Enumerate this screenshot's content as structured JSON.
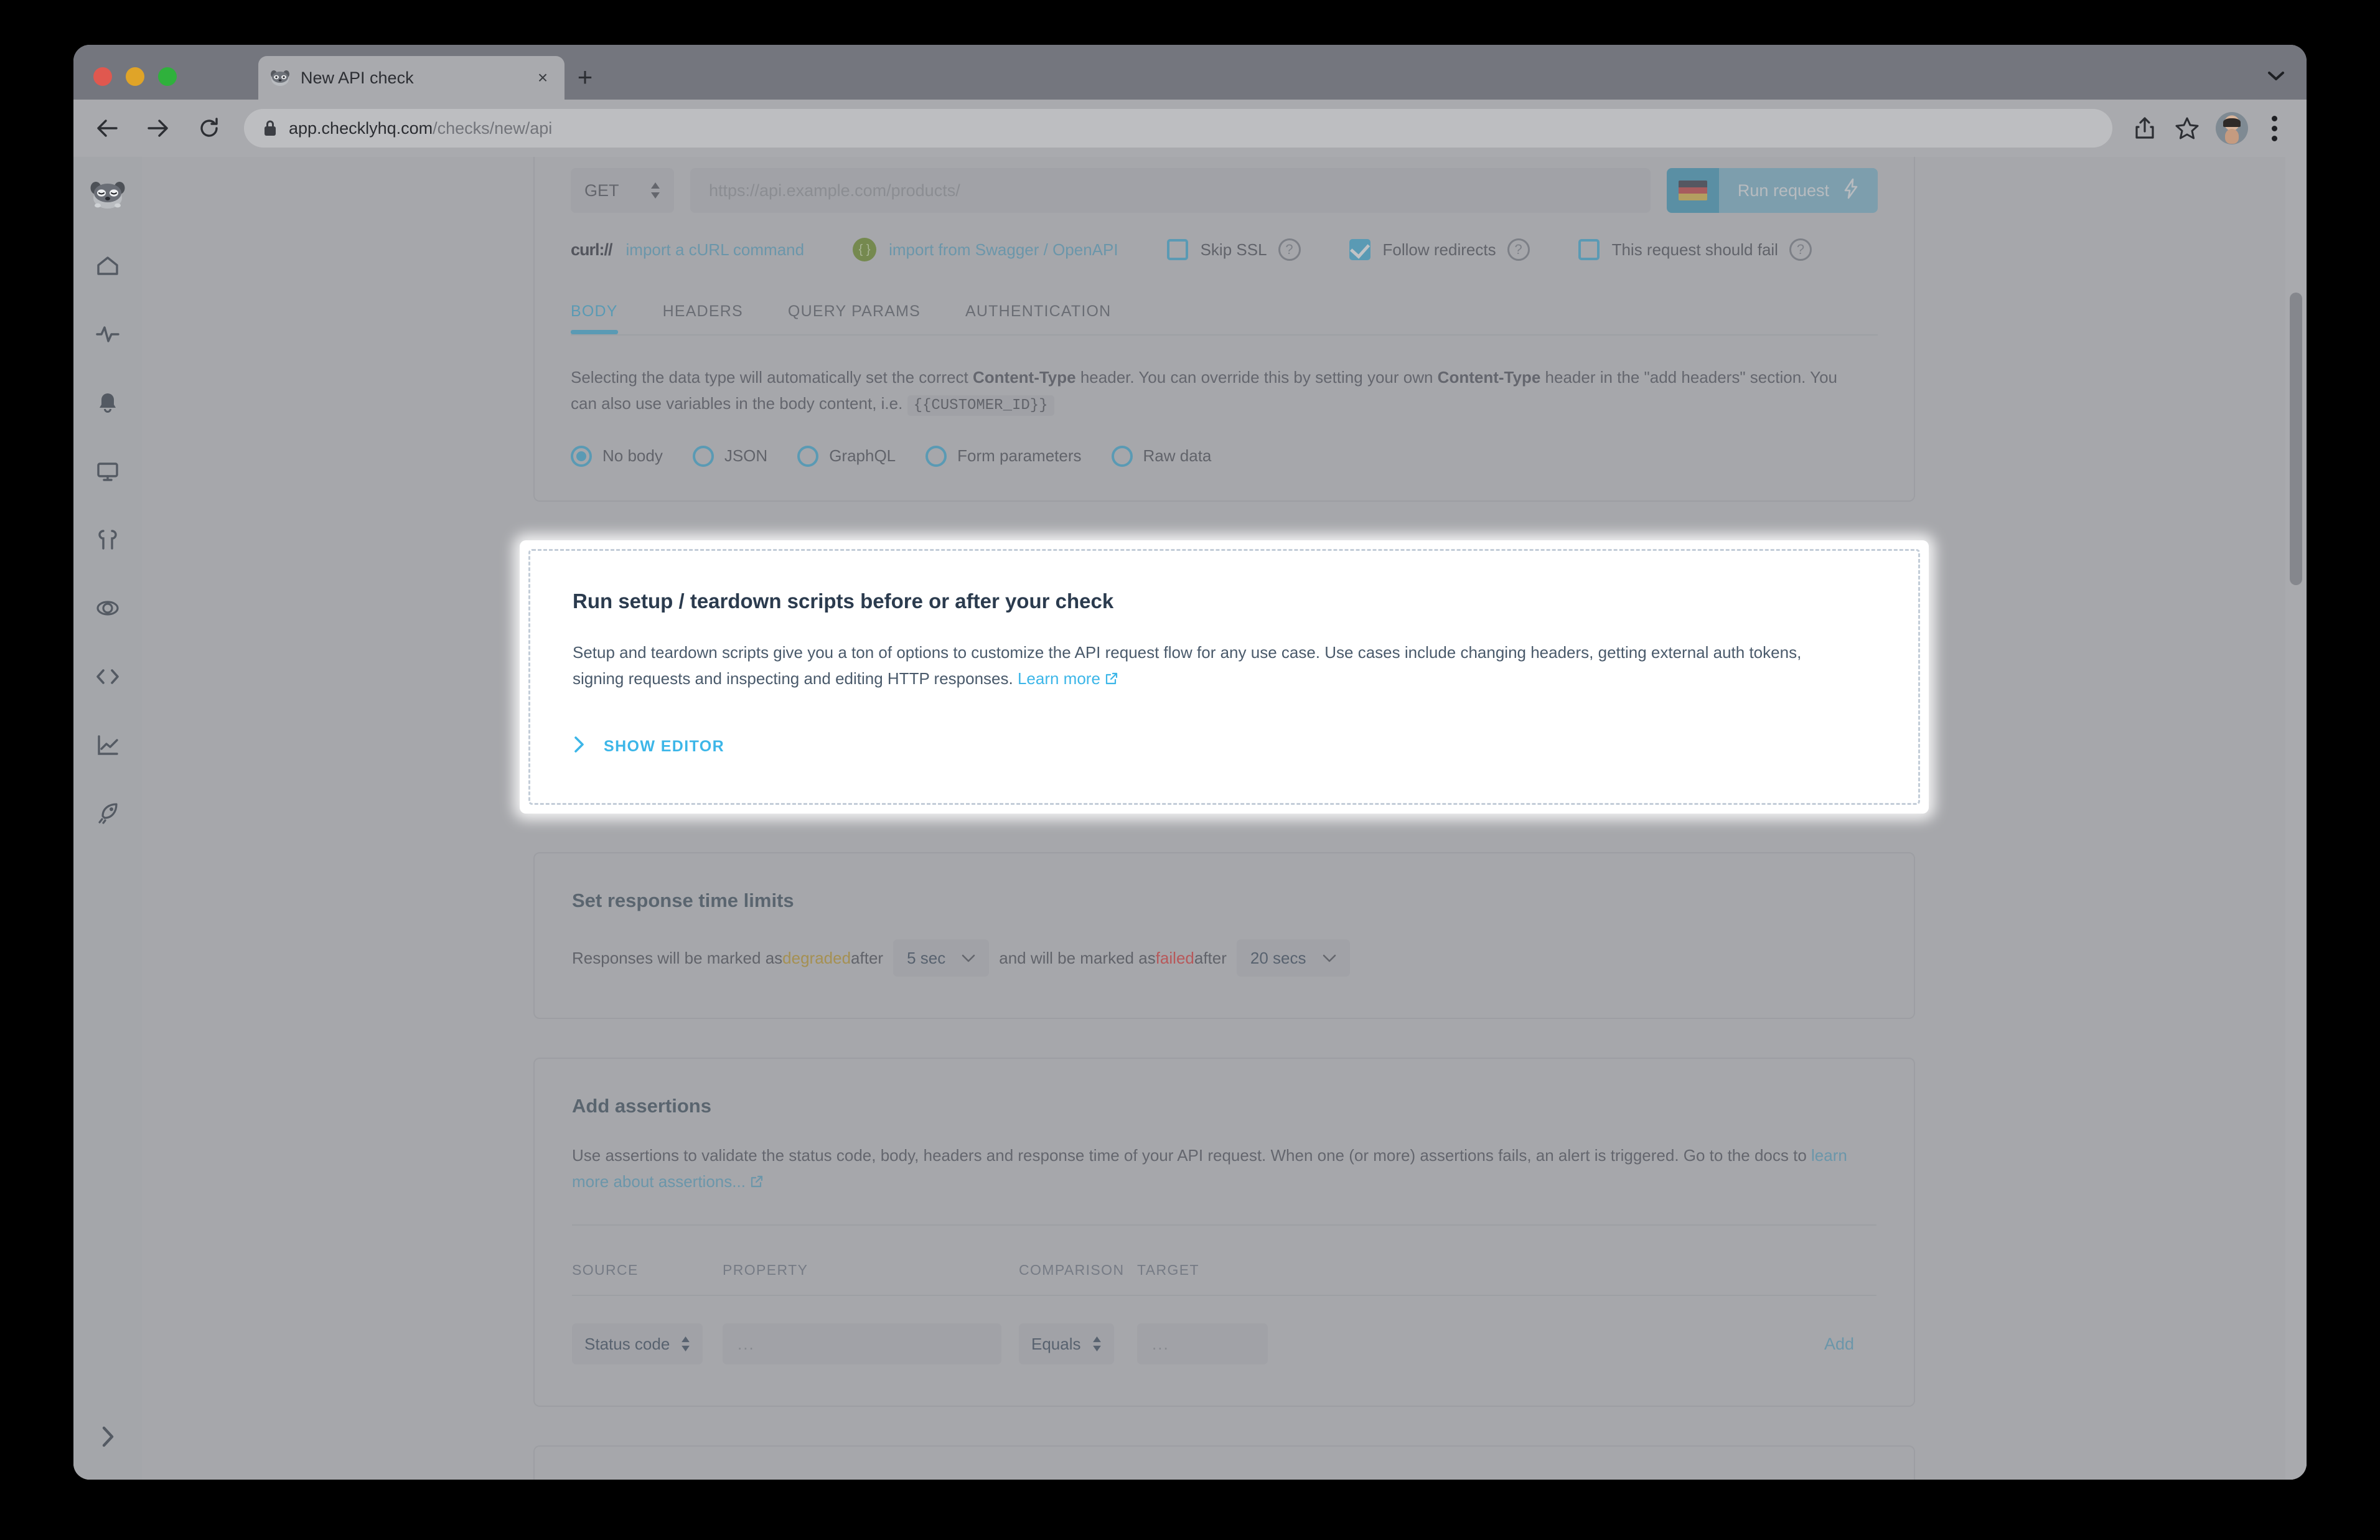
{
  "browser": {
    "tab": {
      "title": "New API check",
      "favicon": "raccoon-icon",
      "close": "×"
    },
    "new_tab": "+",
    "tab_search_icon": "chevron-down-icon",
    "nav": {
      "back": "back-icon",
      "forward": "forward-icon",
      "reload": "reload-icon"
    },
    "omnibox": {
      "lock": "lock-icon",
      "domain": "app.checklyhq.com",
      "path": "/checks/new/api"
    },
    "actions": {
      "share": "share-icon",
      "bookmark": "star-icon",
      "profile": "avatar",
      "menu": "kebab-menu-icon"
    }
  },
  "sidebar": {
    "logo": "checkly-raccoon-logo",
    "items": [
      {
        "name": "home",
        "icon": "home-icon"
      },
      {
        "name": "activity",
        "icon": "pulse-icon"
      },
      {
        "name": "alerts",
        "icon": "bell-icon"
      },
      {
        "name": "dashboards",
        "icon": "monitor-icon"
      },
      {
        "name": "maintenance",
        "icon": "wrench-icon"
      },
      {
        "name": "locations",
        "icon": "globe-icon"
      },
      {
        "name": "code",
        "icon": "code-brackets-icon"
      },
      {
        "name": "analytics",
        "icon": "line-chart-icon"
      },
      {
        "name": "deploy",
        "icon": "rocket-icon"
      }
    ],
    "expand_icon": "chevron-right-icon"
  },
  "request": {
    "method": "GET",
    "method_caret": "updown-caret-icon",
    "url_placeholder": "https://api.example.com/products/",
    "flag": "de-flag-icon",
    "run_label": "Run request",
    "run_icon": "lightning-icon",
    "curl_logo": "curl://",
    "import_curl": "import a cURL command",
    "swagger_icon": "swagger-icon",
    "import_swagger": "import from Swagger / OpenAPI",
    "checkboxes": [
      {
        "label": "Skip SSL",
        "checked": false,
        "help": "?"
      },
      {
        "label": "Follow redirects",
        "checked": true,
        "help": "?"
      },
      {
        "label": "This request should fail",
        "checked": false,
        "help": "?"
      }
    ],
    "tabs": [
      {
        "label": "BODY",
        "active": true
      },
      {
        "label": "HEADERS",
        "active": false
      },
      {
        "label": "QUERY PARAMS",
        "active": false
      },
      {
        "label": "AUTHENTICATION",
        "active": false
      }
    ],
    "body_desc_1": "Selecting the data type will automatically set the correct ",
    "body_desc_ct1": "Content-Type",
    "body_desc_2": " header. You can override this by setting your own ",
    "body_desc_ct2": "Content-Type",
    "body_desc_3": " header in the \"add headers\" section. You can also use variables in the body content, i.e. ",
    "body_variable": "{{CUSTOMER_ID}}",
    "body_options": [
      {
        "label": "No body",
        "selected": true
      },
      {
        "label": "JSON",
        "selected": false
      },
      {
        "label": "GraphQL",
        "selected": false
      },
      {
        "label": "Form parameters",
        "selected": false
      },
      {
        "label": "Raw data",
        "selected": false
      }
    ]
  },
  "scripts_card": {
    "title": "Run setup / teardown scripts before or after your check",
    "description": "Setup and teardown scripts give you a ton of options to customize the API request flow for any use case. Use cases include changing headers, getting external auth tokens, signing requests and inspecting and editing HTTP responses. ",
    "learn_more": "Learn more",
    "external_icon": "external-link-icon",
    "show_editor": "SHOW EDITOR",
    "chevron": "chevron-right-icon",
    "highlight_color": "#ffffff",
    "dashed_border_color": "#c3cdd8"
  },
  "response_limits": {
    "title": "Set response time limits",
    "text_1": "Responses will be marked as ",
    "degraded": "degraded",
    "text_2": " after ",
    "degraded_value": "5 sec",
    "text_3": " and will be marked as ",
    "failed": "failed",
    "text_4": " after ",
    "failed_value": "20 secs",
    "caret": "chevron-down-icon"
  },
  "assertions": {
    "title": "Add assertions",
    "desc_1": "Use assertions to validate the status code, body, headers and response time of your API request. When one (or more) assertions fails, an alert is triggered. Go to the docs to ",
    "desc_link": "learn more about assertions...",
    "external_icon": "external-link-icon",
    "columns": [
      "SOURCE",
      "PROPERTY",
      "COMPARISON",
      "TARGET"
    ],
    "row": {
      "source": "Status code",
      "property_placeholder": "...",
      "comparison": "Equals",
      "target_placeholder": "...",
      "add_label": "Add"
    }
  },
  "colors": {
    "accent": "#2f9cc4",
    "bright_link": "#3cb6e8",
    "degraded": "#b08b1c",
    "failed": "#cf2a2a",
    "heading": "#2b3b4e"
  }
}
